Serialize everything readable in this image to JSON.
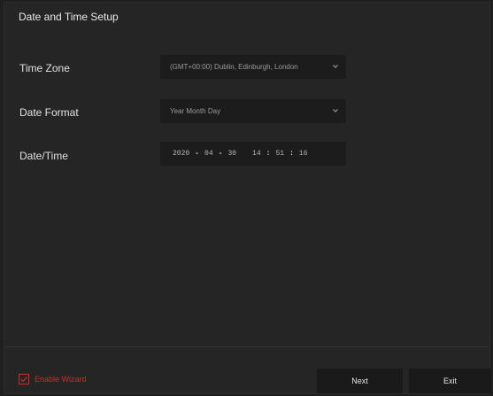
{
  "window": {
    "title": "Date and Time Setup"
  },
  "form": {
    "time_zone": {
      "label": "Time Zone",
      "value": "(GMT+00:00) Dublin, Edinburgh, London"
    },
    "date_format": {
      "label": "Date Format",
      "value": "Year Month Day"
    },
    "date_time": {
      "label": "Date/Time",
      "year": "2020",
      "month": "04",
      "day": "30",
      "hour": "14",
      "minute": "51",
      "second": "16",
      "date_separator": "-",
      "time_separator": ":"
    }
  },
  "footer": {
    "enable_wizard_label": "Enable Wizard",
    "enable_wizard_checked": true,
    "next_label": "Next",
    "exit_label": "Exit"
  },
  "colors": {
    "accent_red": "#c8302b",
    "background": "#252525",
    "field_background": "#1c1c1c"
  }
}
